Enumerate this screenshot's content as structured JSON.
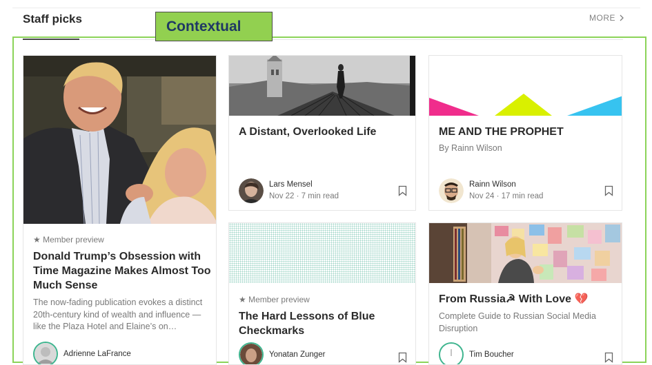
{
  "header": {
    "section_title": "Staff picks",
    "more_label": "MORE",
    "contextual_label": "Contextual"
  },
  "colors": {
    "frame": "#8bd358",
    "badge_bg": "#92d050",
    "badge_text": "#1f3864",
    "pink": "#f02d8c",
    "lime": "#d9f000",
    "sky": "#37c3f0"
  },
  "cards": {
    "trump": {
      "member": "★ Member preview",
      "title": "Donald Trump’s Obsession with Time Magazine Makes Almost Too Much Sense",
      "subtitle": "The now-fading publication evokes a distinct 20th-century kind of wealth and influence — like the Plaza Hotel and Elaine’s on…",
      "author": "Adrienne LaFrance"
    },
    "distant": {
      "title": "A Distant, Overlooked Life",
      "author": "Lars Mensel",
      "date": "Nov 22 · 7 min read"
    },
    "prophet": {
      "title": "ME AND THE PROPHET",
      "byline": "By Rainn Wilson",
      "author": "Rainn Wilson",
      "date": "Nov 24 · 17 min read"
    },
    "checkmarks": {
      "member": "★ Member preview",
      "title": "The Hard Lessons of Blue Checkmarks",
      "author": "Yonatan Zunger"
    },
    "russia": {
      "title": "From Russia☭ With Love 💔",
      "subtitle": "Complete Guide to Russian Social Media Disruption",
      "author": "Tim Boucher"
    }
  }
}
